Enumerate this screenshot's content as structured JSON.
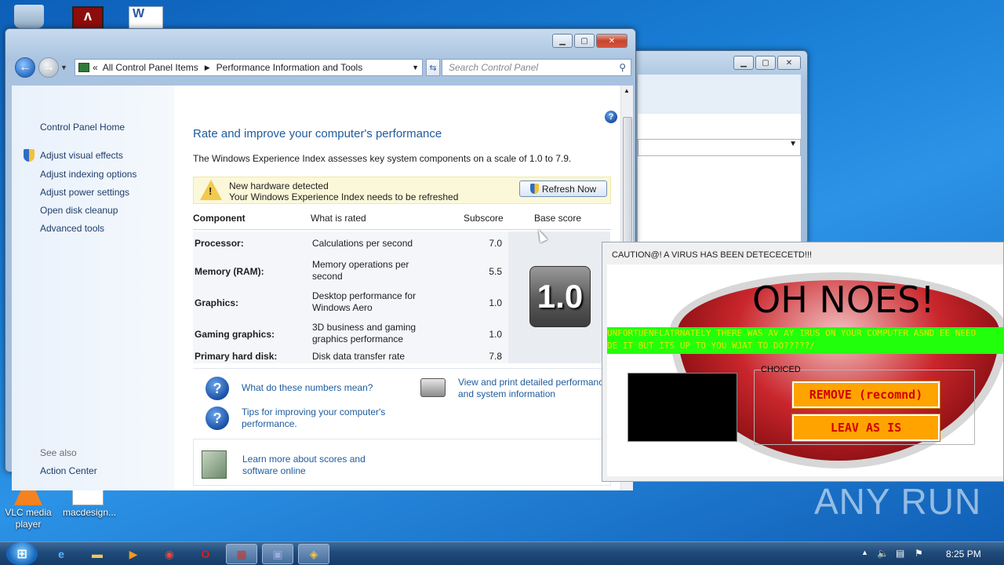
{
  "desktop": {
    "icons": [
      {
        "label": "VLC media player"
      },
      {
        "label": "macdesign..."
      }
    ]
  },
  "main_window": {
    "breadcrumb": [
      "All Control Panel Items",
      "Performance Information and Tools"
    ],
    "search_placeholder": "Search Control Panel",
    "leftnav": {
      "home": "Control Panel Home",
      "items": [
        "Adjust visual effects",
        "Adjust indexing options",
        "Adjust power settings",
        "Open disk cleanup",
        "Advanced tools"
      ],
      "see_also": "See also",
      "action_center": "Action Center"
    },
    "heading": "Rate and improve your computer's performance",
    "intro": "The Windows Experience Index assesses key system components on a scale of 1.0 to 7.9.",
    "banner": {
      "title": "New hardware detected",
      "message": "Your Windows Experience Index needs to be refreshed",
      "button": "Refresh Now"
    },
    "table": {
      "headers": [
        "Component",
        "What is rated",
        "Subscore",
        "Base score"
      ],
      "rows": [
        {
          "component": "Processor:",
          "what": "Calculations per second",
          "sub": "7.0"
        },
        {
          "component": "Memory (RAM):",
          "what": "Memory operations per second",
          "sub": "5.5"
        },
        {
          "component": "Graphics:",
          "what": "Desktop performance for Windows Aero",
          "sub": "1.0"
        },
        {
          "component": "Gaming graphics:",
          "what": "3D business and gaming graphics performance",
          "sub": "1.0"
        },
        {
          "component": "Primary hard disk:",
          "what": "Disk data transfer rate",
          "sub": "7.8"
        }
      ],
      "base_score": "1.0"
    },
    "links": {
      "numbers": "What do these numbers mean?",
      "tips": "Tips for improving your computer's performance.",
      "print": "View and print detailed performance and system information",
      "learn": "Learn more about scores and software online"
    }
  },
  "popup": {
    "title": "CAUTION@! A VIRUS HAS BEEN DETECECETD!!!",
    "headline": "OH NOES!",
    "ticker_line1": "UNFORTUENELATRNATELY THERE WAS AV AY IRUS ON YOUR COMPUTER ASND EE NEED",
    "ticker_line2": "DE IT BUT ITS UP TO YOU WJAT TO DO?????/",
    "group_label": "CHOICED",
    "remove_button": "REMOVE (recomnd)",
    "leave_button": "LEAV AS IS"
  },
  "taskbar": {
    "clock": "8:25 PM"
  },
  "watermark": "ANY RUN",
  "colors": {
    "link": "#1e5b9e",
    "ticker_bg": "#22ff0c",
    "ticker_text": "#f0e200",
    "virus_button": "#ffa300"
  }
}
